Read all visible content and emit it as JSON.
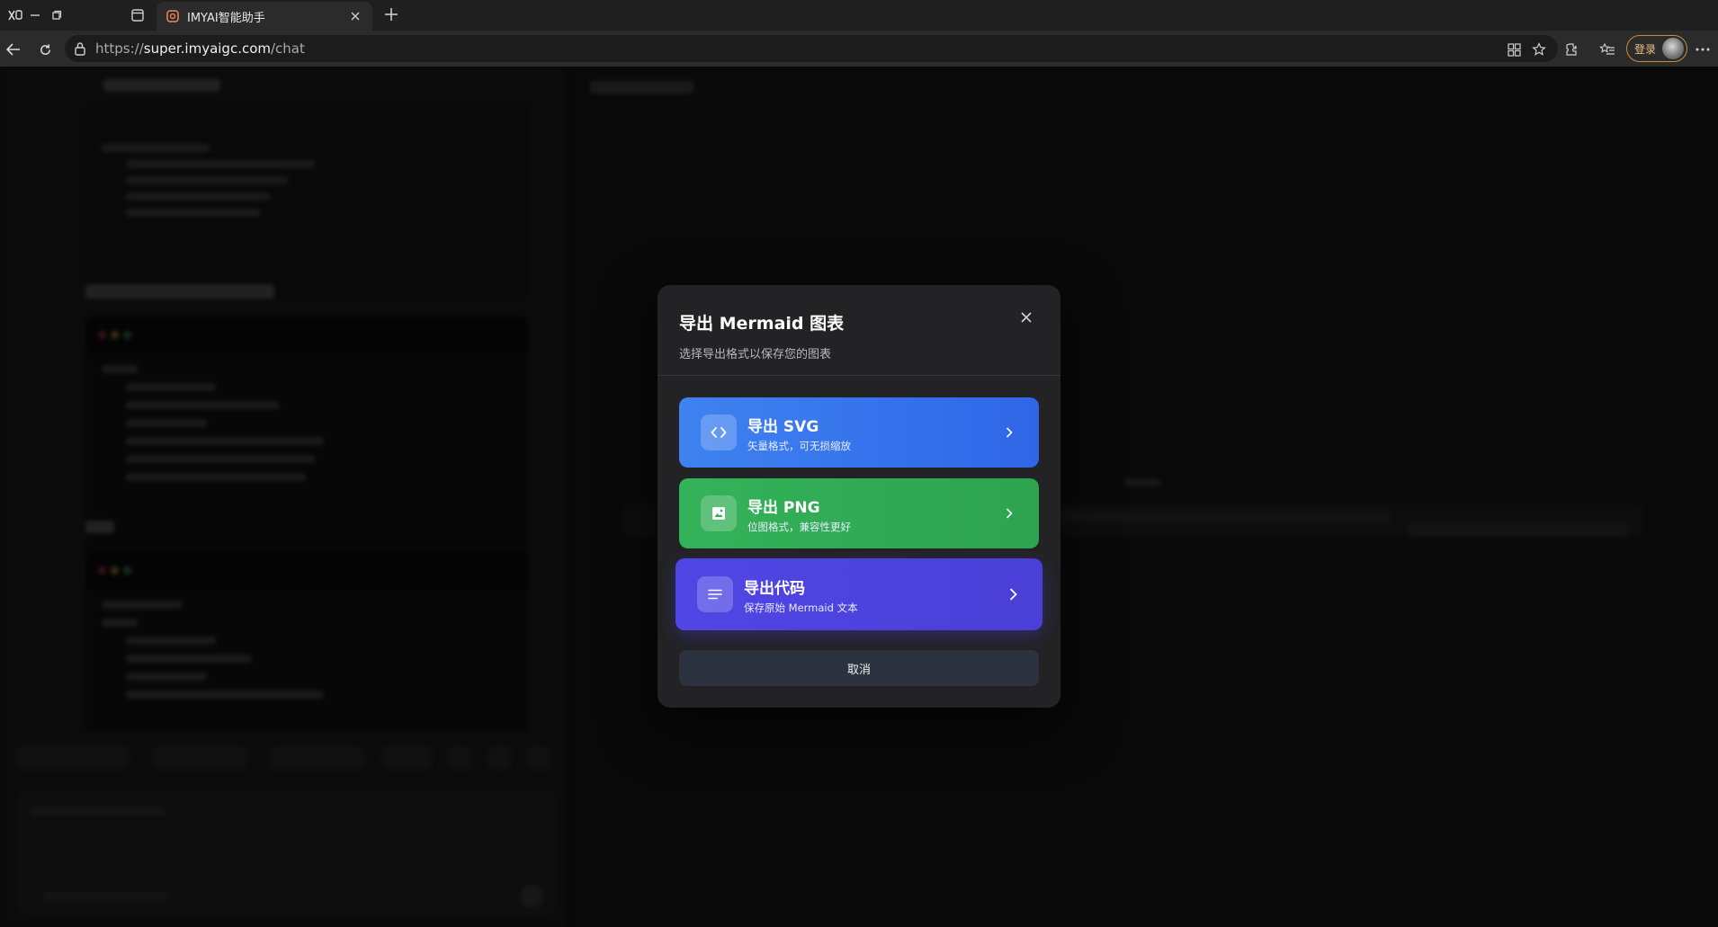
{
  "browser": {
    "tab_title": "IMYAI智能助手",
    "url_scheme": "https://",
    "url_host": "super.imyaigc.com",
    "url_path": "/chat",
    "login_label": "登录"
  },
  "modal": {
    "title": "导出 Mermaid 图表",
    "subtitle": "选择导出格式以保存您的图表",
    "options": [
      {
        "label": "导出 SVG",
        "description": "矢量格式，可无损缩放",
        "icon": "code-brackets-icon",
        "color": "#3b7bef"
      },
      {
        "label": "导出 PNG",
        "description": "位图格式，兼容性更好",
        "icon": "image-icon",
        "color": "#33ad57"
      },
      {
        "label": "导出代码",
        "description": "保存原始 Mermaid 文本",
        "icon": "text-lines-icon",
        "color": "#4f46e5"
      }
    ],
    "cancel_label": "取消"
  }
}
